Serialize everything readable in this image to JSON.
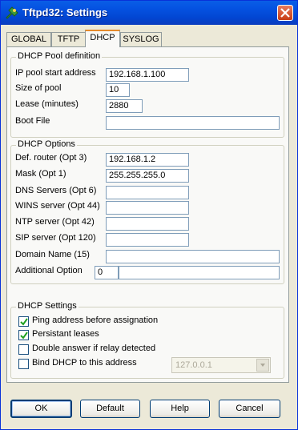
{
  "window": {
    "title": "Tftpd32: Settings"
  },
  "tabs": [
    {
      "label": "GLOBAL"
    },
    {
      "label": "TFTP"
    },
    {
      "label": "DHCP",
      "active": true
    },
    {
      "label": "SYSLOG"
    }
  ],
  "pool": {
    "title": "DHCP Pool definition",
    "ip_start_label": "IP pool start address",
    "ip_start_value": "192.168.1.100",
    "size_label": "Size of pool",
    "size_value": "10",
    "lease_label": "Lease (minutes)",
    "lease_value": "2880",
    "boot_label": "Boot File",
    "boot_value": ""
  },
  "options": {
    "title": "DHCP Options",
    "router_label": "Def. router (Opt 3)",
    "router_value": "192.168.1.2",
    "mask_label": "Mask (Opt 1)",
    "mask_value": "255.255.255.0",
    "dns_label": "DNS Servers (Opt 6)",
    "dns_value": "",
    "wins_label": "WINS server (Opt 44)",
    "wins_value": "",
    "ntp_label": "NTP server (Opt 42)",
    "ntp_value": "",
    "sip_label": "SIP server (Opt 120)",
    "sip_value": "",
    "domain_label": "Domain Name (15)",
    "domain_value": "",
    "additional_label": "Additional Option",
    "additional_num": "0",
    "additional_value": ""
  },
  "settings": {
    "title": "DHCP Settings",
    "ping_label": "Ping address before assignation",
    "ping_checked": true,
    "persist_label": "Persistant leases",
    "persist_checked": true,
    "double_label": "Double answer if relay detected",
    "double_checked": false,
    "bind_label": "Bind DHCP to this address",
    "bind_checked": false,
    "bind_address": "127.0.0.1"
  },
  "buttons": {
    "ok": "OK",
    "default": "Default",
    "help": "Help",
    "cancel": "Cancel"
  },
  "colors": {
    "titlebar": "#0553E2",
    "tab_highlight": "#E68B2C",
    "dialog_face": "#ECE9D8"
  }
}
